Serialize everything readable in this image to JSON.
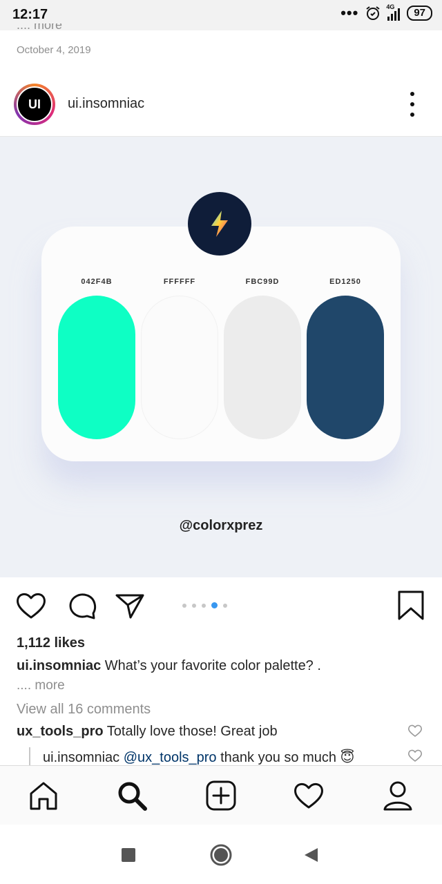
{
  "status_bar": {
    "time": "12:17",
    "more_dots": "•••",
    "network": "4G",
    "battery": "97"
  },
  "post": {
    "prev_caption_more": ".... more",
    "date": "October 4, 2019",
    "author": {
      "avatar_text": "UI",
      "username": "ui.insomniac"
    },
    "image": {
      "swatches": [
        {
          "label": "042F4B",
          "color": "#0effc4"
        },
        {
          "label": "FFFFFF",
          "color": "#fbfbfb"
        },
        {
          "label": "FBC99D",
          "color": "#ececec"
        },
        {
          "label": "ED1250",
          "color": "#20476a"
        }
      ],
      "watermark": "@colorxprez",
      "badge_icon": "lightning-bolt-icon"
    },
    "carousel": {
      "count": 5,
      "active_index": 3,
      "active_color": "#3897f0"
    },
    "likes": "1,112 likes",
    "caption": {
      "username": "ui.insomniac",
      "text": " What’s your favorite color palette? ."
    },
    "caption_more": ".... more",
    "view_comments": "View all 16 comments",
    "comments": [
      {
        "username": "ux_tools_pro",
        "text": " Totally love those! Great job"
      }
    ],
    "replies": [
      {
        "username": "ui.insomniac",
        "mention": "@ux_tools_pro",
        "text": " thank you so much 😇",
        "mention_color": "#003569"
      }
    ]
  },
  "bottom_nav": [
    "home-icon",
    "search-icon",
    "add-post-icon",
    "activity-heart-icon",
    "profile-icon"
  ],
  "android_nav": [
    "recents-square-icon",
    "home-circle-icon",
    "back-triangle-icon"
  ]
}
